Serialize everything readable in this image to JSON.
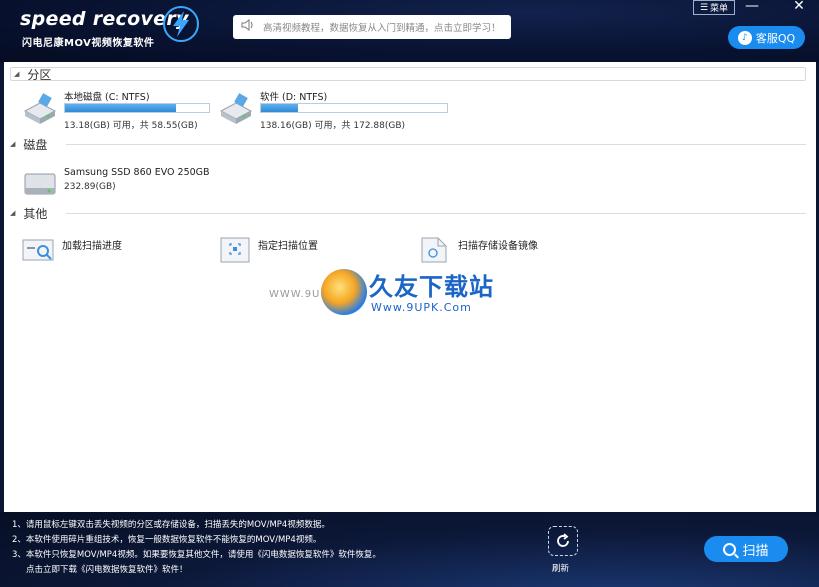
{
  "header": {
    "logo_title": "speed recovery",
    "logo_subtitle": "闪电尼康MOV视频恢复软件",
    "notice": "高清视频教程，数据恢复从入门到精通，点击立即学习！",
    "menu_label": "菜单",
    "minimize_glyph": "—",
    "close_glyph": "✕",
    "service_label": "客服QQ"
  },
  "sections": {
    "partition": {
      "title": "分区",
      "drives": [
        {
          "name": "本地磁盘 (C: NTFS)",
          "used_pct": 77,
          "info": "13.18(GB) 可用，共 58.55(GB)"
        },
        {
          "name": "软件 (D: NTFS)",
          "used_pct": 20,
          "info": "138.16(GB) 可用，共 172.88(GB)"
        }
      ]
    },
    "disk": {
      "title": "磁盘",
      "disks": [
        {
          "name": "Samsung SSD 860 EVO 250GB",
          "info": "232.89(GB)"
        }
      ]
    },
    "other": {
      "title": "其他",
      "items": [
        {
          "label": "加载扫描进度"
        },
        {
          "label": "指定扫描位置"
        },
        {
          "label": "扫描存储设备镜像"
        }
      ]
    }
  },
  "watermark": {
    "url_left": "WWW.9UPK.COM",
    "title": "久友下载站",
    "subtitle": "Www.9UPK.Com"
  },
  "footer": {
    "tips": [
      "1、请用鼠标左键双击丢失视频的分区或存储设备，扫描丢失的MOV/MP4视频数据。",
      "2、本软件使用碎片重组技术，恢复一般数据恢复软件不能恢复的MOV/MP4视频。",
      "3、本软件只恢复MOV/MP4视频。如果要恢复其他文件，请使用《闪电数据恢复软件》软件恢复。",
      "点击立即下载《闪电数据恢复软件》软件！"
    ],
    "refresh_label": "刷新",
    "scan_label": "扫描"
  },
  "colors": {
    "accent": "#1a8cf0",
    "header_bg": "#081230",
    "bar_fill": "#2f8ad8"
  }
}
